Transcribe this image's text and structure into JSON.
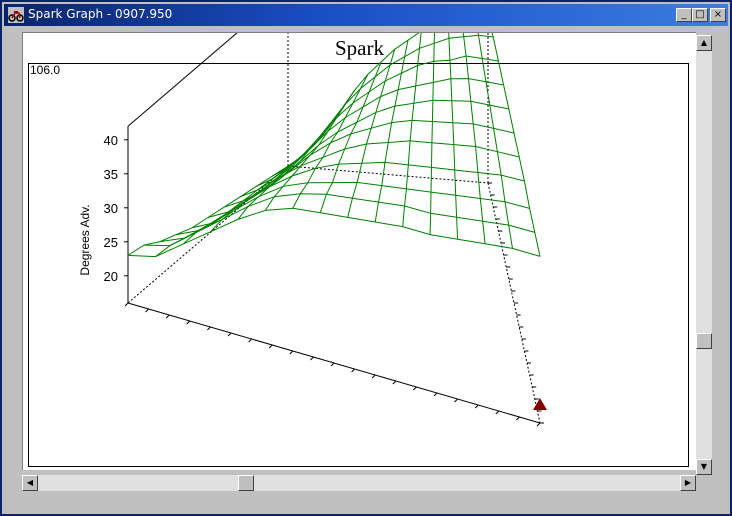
{
  "window": {
    "title": "Spark Graph - 0907.950",
    "buttons": {
      "minimize": "_",
      "maximize": "□",
      "close": "×"
    },
    "titlebar_color": "#0a246a",
    "app_icon": "motorcycle-icon"
  },
  "chart_data": {
    "type": "surface3d",
    "title": "Spark",
    "zlabel": "Degrees Adv.",
    "max_label": "106.0",
    "zlim": [
      16,
      42
    ],
    "z_ticks": [
      "40",
      "35",
      "30",
      "25",
      "20"
    ],
    "mesh_color": "#008000",
    "grid": [
      [
        23,
        24,
        27,
        30,
        33,
        35.5,
        37,
        37.5,
        38,
        38.5,
        39,
        39,
        39.5,
        40,
        40.5,
        40.5
      ],
      [
        22.5,
        23.5,
        26.5,
        29.5,
        32.5,
        35,
        36.5,
        37.5,
        38,
        38.5,
        39,
        39,
        39.5,
        40,
        40.5,
        40.5
      ],
      [
        21,
        22.5,
        25.5,
        28.5,
        31.5,
        34,
        35.5,
        36.5,
        37.5,
        38,
        38.5,
        39,
        39.5,
        40,
        40.5,
        40.5
      ],
      [
        20,
        21.5,
        24.5,
        27.5,
        30.5,
        33,
        35,
        36.5,
        37.5,
        38.5,
        39,
        39.5,
        40,
        40.5,
        41,
        41
      ],
      [
        19,
        20.5,
        23.5,
        26.5,
        29.5,
        32,
        34,
        36,
        37.5,
        38.5,
        39.5,
        40,
        40.5,
        41,
        41,
        41
      ],
      [
        18.5,
        20,
        22.5,
        25,
        28,
        31,
        33.5,
        35.5,
        37,
        38.5,
        39.5,
        40,
        40.5,
        41,
        41,
        41
      ],
      [
        18,
        19.5,
        21.5,
        24,
        27,
        30,
        32.5,
        34.5,
        36.5,
        38,
        39,
        40,
        40.5,
        41,
        41,
        41
      ],
      [
        17.5,
        19,
        21,
        23.5,
        26.5,
        29.5,
        32,
        34,
        36,
        37.5,
        38.5,
        39.5,
        40.5,
        41,
        41,
        41
      ],
      [
        17,
        18.5,
        20.5,
        23,
        26,
        29,
        31.5,
        33.5,
        35.5,
        37,
        38.5,
        39.5,
        40,
        41,
        41,
        41
      ],
      [
        16.5,
        18,
        20,
        22.5,
        25.5,
        28.5,
        31,
        33,
        35,
        36.5,
        38,
        39,
        40,
        40.5,
        41,
        41
      ],
      [
        16,
        17.5,
        19.5,
        22,
        25,
        28,
        30.5,
        32.5,
        34.5,
        36,
        37.5,
        38.5,
        39.5,
        40,
        40.5,
        40.5
      ]
    ],
    "marker_color": "#800000"
  },
  "scrollbars": {
    "vertical_position": 0.72,
    "horizontal_position": 0.32
  }
}
